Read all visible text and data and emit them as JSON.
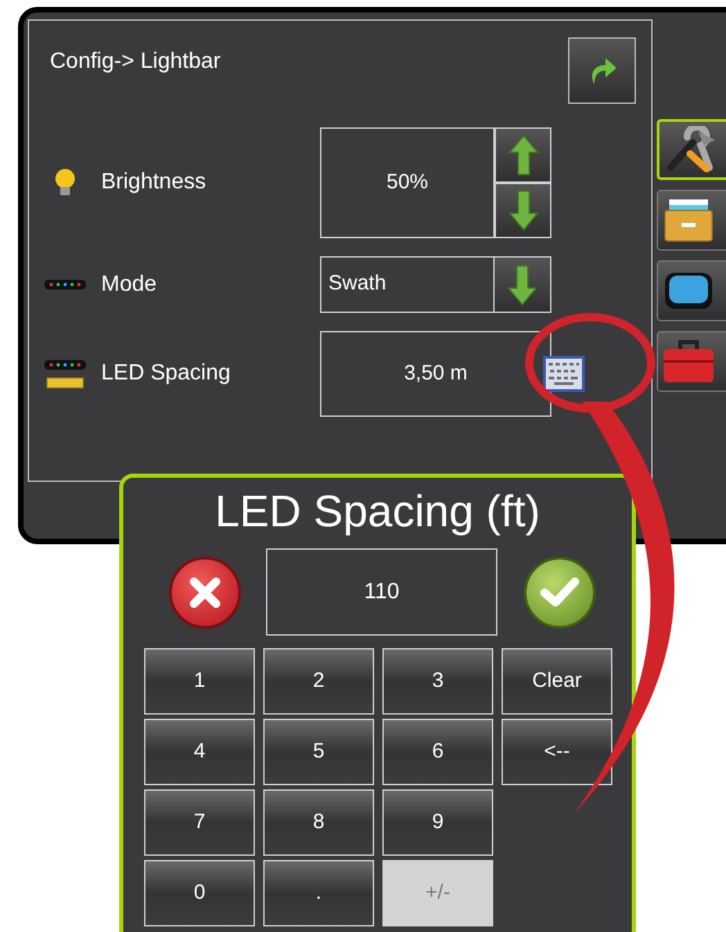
{
  "screen": {
    "title": "Config-> Lightbar"
  },
  "settings": [
    {
      "kind": "stepper",
      "label": "Brightness",
      "value": "50%"
    },
    {
      "kind": "dropdown",
      "label": "Mode",
      "value": "Swath"
    },
    {
      "kind": "keyboard",
      "label": "LED Spacing",
      "value": "3,50 m"
    }
  ],
  "side_tabs": [
    {
      "kind": "tools",
      "selected": true
    },
    {
      "kind": "cabinet",
      "selected": false
    },
    {
      "kind": "display",
      "selected": false
    },
    {
      "kind": "toolbox",
      "selected": false
    }
  ],
  "keypad": {
    "title": "LED Spacing (ft)",
    "value": "110",
    "key_rows": [
      [
        {
          "label": "1",
          "disabled": false
        },
        {
          "label": "2",
          "disabled": false
        },
        {
          "label": "3",
          "disabled": false
        },
        {
          "label": "Clear",
          "disabled": false
        }
      ],
      [
        {
          "label": "4",
          "disabled": false
        },
        {
          "label": "5",
          "disabled": false
        },
        {
          "label": "6",
          "disabled": false
        },
        {
          "label": "<--",
          "disabled": false
        }
      ],
      [
        {
          "label": "7",
          "disabled": false
        },
        {
          "label": "8",
          "disabled": false
        },
        {
          "label": "9",
          "disabled": false
        }
      ],
      [
        {
          "label": "0",
          "disabled": false
        },
        {
          "label": ".",
          "disabled": false
        },
        {
          "label": "+/-",
          "disabled": true
        }
      ]
    ]
  }
}
